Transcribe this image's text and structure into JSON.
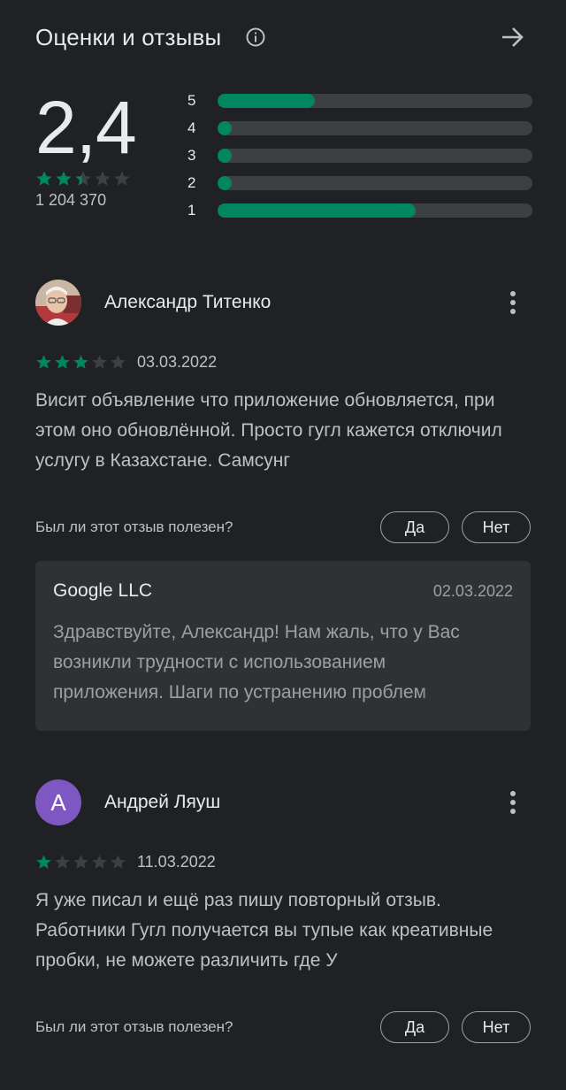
{
  "header": {
    "title": "Оценки и отзывы",
    "info_icon": "info-icon",
    "arrow_icon": "arrow-right-icon"
  },
  "summary": {
    "rating": "2,4",
    "stars_value": 2.4,
    "count": "1 204 370"
  },
  "histogram": [
    {
      "label": "5",
      "fraction": 0.31
    },
    {
      "label": "4",
      "fraction": 0.02
    },
    {
      "label": "3",
      "fraction": 0.02
    },
    {
      "label": "2",
      "fraction": 0.02
    },
    {
      "label": "1",
      "fraction": 0.63
    }
  ],
  "reviews": [
    {
      "author": "Александр Титенко",
      "avatar_type": "photo",
      "stars": 3,
      "date": "03.03.2022",
      "text": "Висит объявление что приложение обновляется, при этом оно обновлённой. Просто гугл кажется отключил услугу в Казахстане. Самсунг",
      "helpful_question": "Был ли этот отзыв полезен?",
      "yes_label": "Да",
      "no_label": "Нет",
      "developer_reply": {
        "name": "Google LLC",
        "date": "02.03.2022",
        "text": "Здравствуйте, Александр! Нам жаль, что у Вас возникли трудности с использованием приложения. Шаги по устранению проблем"
      }
    },
    {
      "author": "Андрей Ляуш",
      "avatar_type": "letter",
      "avatar_letter": "А",
      "stars": 1,
      "date": "11.03.2022",
      "text": "Я уже писал и ещё раз пишу повторный отзыв. Работники Гугл получается вы тупые как креативные пробки, не можете различить где У",
      "helpful_question": "Был ли этот отзыв полезен?",
      "yes_label": "Да",
      "no_label": "Нет"
    }
  ],
  "colors": {
    "background": "#202124",
    "accent_green": "#01875f",
    "track": "#3c4043",
    "reply_bg": "#303134",
    "avatar_letter_bg": "#7e57c2"
  }
}
